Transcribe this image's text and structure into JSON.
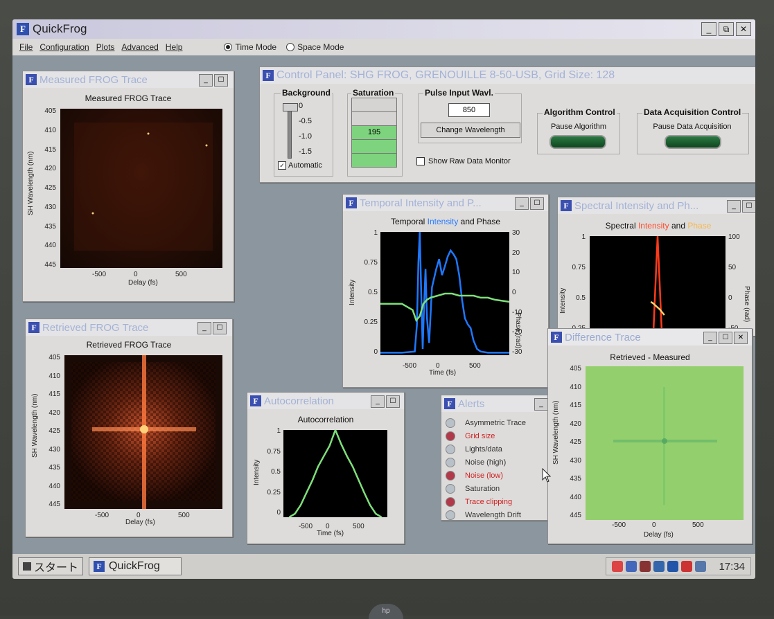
{
  "app": {
    "title": "QuickFrog",
    "icon_letter": "F"
  },
  "window_buttons": [
    "_",
    "⧉",
    "✕"
  ],
  "menu": [
    "File",
    "Configuration",
    "Plots",
    "Advanced",
    "Help"
  ],
  "mode": {
    "time_label": "Time Mode",
    "space_label": "Space Mode",
    "selected": "Time Mode"
  },
  "measured": {
    "window_title": "Measured FROG Trace",
    "plot_title": "Measured FROG Trace",
    "ylabel": "SH Wavelength (nm)",
    "xlabel": "Delay (fs)",
    "yticks": [
      "405",
      "410",
      "415",
      "420",
      "425",
      "430",
      "435",
      "440",
      "445"
    ],
    "xticks": [
      "-500",
      "0",
      "500"
    ]
  },
  "retrieved": {
    "window_title": "Retrieved FROG Trace",
    "plot_title": "Retrieved FROG Trace",
    "ylabel": "SH Wavelength (nm)",
    "xlabel": "Delay (fs)",
    "yticks": [
      "405",
      "410",
      "415",
      "420",
      "425",
      "430",
      "435",
      "440",
      "445"
    ],
    "xticks": [
      "-500",
      "0",
      "500"
    ]
  },
  "control": {
    "window_title": "Control Panel: SHG FROG, GRENOUILLE 8-50-USB, Grid Size: 128",
    "background_label": "Background",
    "background_ticks": [
      "0",
      "-0.5",
      "-1.0",
      "-1.5"
    ],
    "automatic_label": "Automatic",
    "automatic_checked": true,
    "saturation_label": "Saturation",
    "saturation_value": "195",
    "pulse_label": "Pulse Input Wavl.",
    "pulse_value": "850",
    "change_wavelength": "Change Wavelength",
    "show_raw": "Show Raw Data Monitor",
    "algorithm_label": "Algorithm Control",
    "pause_algorithm": "Pause Algorithm",
    "daq_label": "Data Acquisition Control",
    "pause_daq": "Pause Data Acquisition"
  },
  "temporal": {
    "window_title": "Temporal Intensity and P...",
    "title_a": "Temporal ",
    "title_b": "Intensity",
    "title_c": " and Phase",
    "ylabel": "Intensity",
    "y2label": "Phase (rad)",
    "xlabel": "Time (fs)",
    "yticks": [
      "1",
      "0.75",
      "0.5",
      "0.25",
      "0"
    ],
    "y2ticks": [
      "30",
      "20",
      "10",
      "0",
      "-10",
      "-20",
      "-30"
    ],
    "xticks": [
      "-500",
      "0",
      "500"
    ]
  },
  "spectral": {
    "window_title": "Spectral Intensity and Ph...",
    "title_a": "Spectral ",
    "title_b": "Intensity",
    "title_c": " and ",
    "title_d": "Phase",
    "ylabel": "Intensity",
    "y2label": "Phase (rad)",
    "yticks": [
      "1",
      "0.75",
      "0.5",
      "0.25"
    ],
    "y2ticks": [
      "100",
      "50",
      "0",
      "-50"
    ]
  },
  "difference": {
    "window_title": "Difference Trace",
    "plot_title": "Retrieved - Measured",
    "ylabel": "SH Wavelength (nm)",
    "xlabel": "Delay (fs)",
    "yticks": [
      "405",
      "410",
      "415",
      "420",
      "425",
      "430",
      "435",
      "440",
      "445"
    ],
    "xticks": [
      "-500",
      "0",
      "500"
    ]
  },
  "autocorrelation": {
    "window_title": "Autocorrelation",
    "plot_title": "Autocorrelation",
    "ylabel": "Intensity",
    "xlabel": "Time (fs)",
    "yticks": [
      "1",
      "0.75",
      "0.5",
      "0.25",
      "0"
    ],
    "xticks": [
      "-500",
      "0",
      "500"
    ]
  },
  "alerts": {
    "window_title": "Alerts",
    "items": [
      {
        "label": "Asymmetric Trace",
        "state": "off"
      },
      {
        "label": "Grid size",
        "state": "on"
      },
      {
        "label": "Lights/data",
        "state": "off"
      },
      {
        "label": "Noise (high)",
        "state": "off"
      },
      {
        "label": "Noise (low)",
        "state": "on"
      },
      {
        "label": "Saturation",
        "state": "off"
      },
      {
        "label": "Trace clipping",
        "state": "on"
      },
      {
        "label": "Wavelength Drift",
        "state": "off"
      }
    ]
  },
  "taskbar": {
    "start_label": "スタート",
    "task_label": "QuickFrog",
    "clock": "17:34"
  },
  "colors": {
    "intensity_blue": "#1e78ff",
    "phase_green": "#7ee07a",
    "spectral_red": "#ff3a1a",
    "spectral_phase": "#f5d070",
    "diff_bg": "#93cf6c",
    "alert_red": "#cc2222"
  },
  "chart_data": [
    {
      "type": "line",
      "title": "Temporal Intensity and Phase",
      "xlabel": "Time (fs)",
      "ylabel": "Intensity",
      "y2label": "Phase (rad)",
      "xlim": [
        -900,
        900
      ],
      "ylim": [
        0,
        1
      ],
      "y2lim": [
        -30,
        30
      ],
      "series": [
        {
          "name": "Intensity",
          "axis": "left",
          "x": [
            -900,
            -600,
            -420,
            -390,
            -370,
            -350,
            -330,
            -310,
            -290,
            -270,
            -250,
            -220,
            -180,
            -120,
            -80,
            -40,
            0,
            40,
            80,
            120,
            160,
            200,
            240,
            280,
            320,
            360,
            400,
            450,
            500,
            600,
            700,
            900
          ],
          "y": [
            0.02,
            0.02,
            0.03,
            0.25,
            0.75,
            1.0,
            0.5,
            0.05,
            0.4,
            0.7,
            0.3,
            0.1,
            0.55,
            0.7,
            0.78,
            0.65,
            0.72,
            0.8,
            0.85,
            0.82,
            0.78,
            0.65,
            0.45,
            0.3,
            0.25,
            0.22,
            0.12,
            0.05,
            0.03,
            0.02,
            0.02,
            0.02
          ]
        },
        {
          "name": "Phase",
          "axis": "right",
          "x": [
            -900,
            -600,
            -450,
            -400,
            -350,
            -300,
            -250,
            -200,
            -100,
            0,
            100,
            200,
            300,
            400,
            500,
            600,
            700,
            900
          ],
          "y": [
            -5,
            -5,
            -8,
            -13,
            -11,
            -5,
            -3,
            -2,
            -1,
            0,
            0,
            -1,
            -1,
            -1,
            -2,
            -2,
            -3,
            -4
          ]
        }
      ]
    },
    {
      "type": "line",
      "title": "Spectral Intensity and Phase",
      "ylabel": "Intensity",
      "y2label": "Phase (rad)",
      "ylim": [
        0,
        1
      ],
      "y2lim": [
        -50,
        100
      ],
      "series": [
        {
          "name": "Intensity",
          "axis": "left",
          "x": [
            -4,
            -2,
            0,
            2,
            4
          ],
          "y": [
            0,
            0.5,
            1.0,
            0.5,
            0
          ]
        },
        {
          "name": "Phase",
          "axis": "right",
          "x": [
            -6,
            -4,
            -2,
            0,
            2,
            4,
            6
          ],
          "y": [
            5,
            3,
            0,
            -3,
            -6,
            -10,
            -14
          ]
        }
      ]
    },
    {
      "type": "line",
      "title": "Autocorrelation",
      "xlabel": "Time (fs)",
      "ylabel": "Intensity",
      "xlim": [
        -900,
        900
      ],
      "ylim": [
        0,
        1
      ],
      "series": [
        {
          "name": "Autocorrelation",
          "x": [
            -800,
            -700,
            -600,
            -500,
            -400,
            -300,
            -200,
            -100,
            0,
            100,
            200,
            300,
            400,
            500,
            600,
            700,
            800
          ],
          "y": [
            0.0,
            0.04,
            0.14,
            0.28,
            0.42,
            0.58,
            0.7,
            0.82,
            1.0,
            0.84,
            0.7,
            0.58,
            0.43,
            0.28,
            0.14,
            0.04,
            0.0
          ]
        }
      ]
    }
  ]
}
